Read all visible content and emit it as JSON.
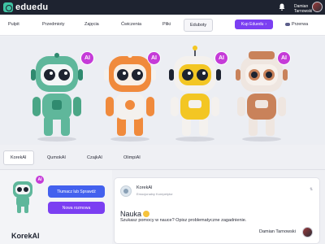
{
  "app": {
    "name": "eduedu"
  },
  "header": {
    "user_name": "Damian Tarnowski"
  },
  "nav": {
    "items": [
      "Pulpit",
      "Przedmioty",
      "Zajęcia",
      "Ćwiczenia",
      "Pliki",
      "Eduboty"
    ],
    "active": "Eduboty",
    "cta_label": "Kup Eduedu",
    "break_label": "Przerwa"
  },
  "gallery": {
    "badge_label": "AI",
    "robots": [
      {
        "color": "#5fb79b",
        "accent": "#2f8a6f"
      },
      {
        "color": "#f08a3c",
        "accent": "#f4f1ee"
      },
      {
        "color": "#f3c623",
        "accent": "#f4f1ee"
      },
      {
        "color": "#c9825a",
        "accent": "#efe6e0"
      }
    ]
  },
  "tabs": [
    "KorekAI",
    "QumokAI",
    "CzajkAI",
    "OlimpiAI"
  ],
  "active_tab": "KorekAI",
  "panel": {
    "badge": "AI",
    "primary_button": "Tłumacz lub Sprawdź",
    "secondary_button": "Nowa rozmowa",
    "bot_name": "KorekAI"
  },
  "chat": {
    "sender": "KorekAI",
    "sender_role": "Emocjonalny Korepetytor",
    "title": "Nauka",
    "message": "Szukasz pomocy w nauce? Opisz problematyczne zagadnienie.",
    "reply_user": "Damian Tarnowski"
  },
  "colors": {
    "brand": "#3fc4a4",
    "primary": "#4361ee",
    "purple": "#7b3ff2",
    "badge": "#c53bd8"
  }
}
